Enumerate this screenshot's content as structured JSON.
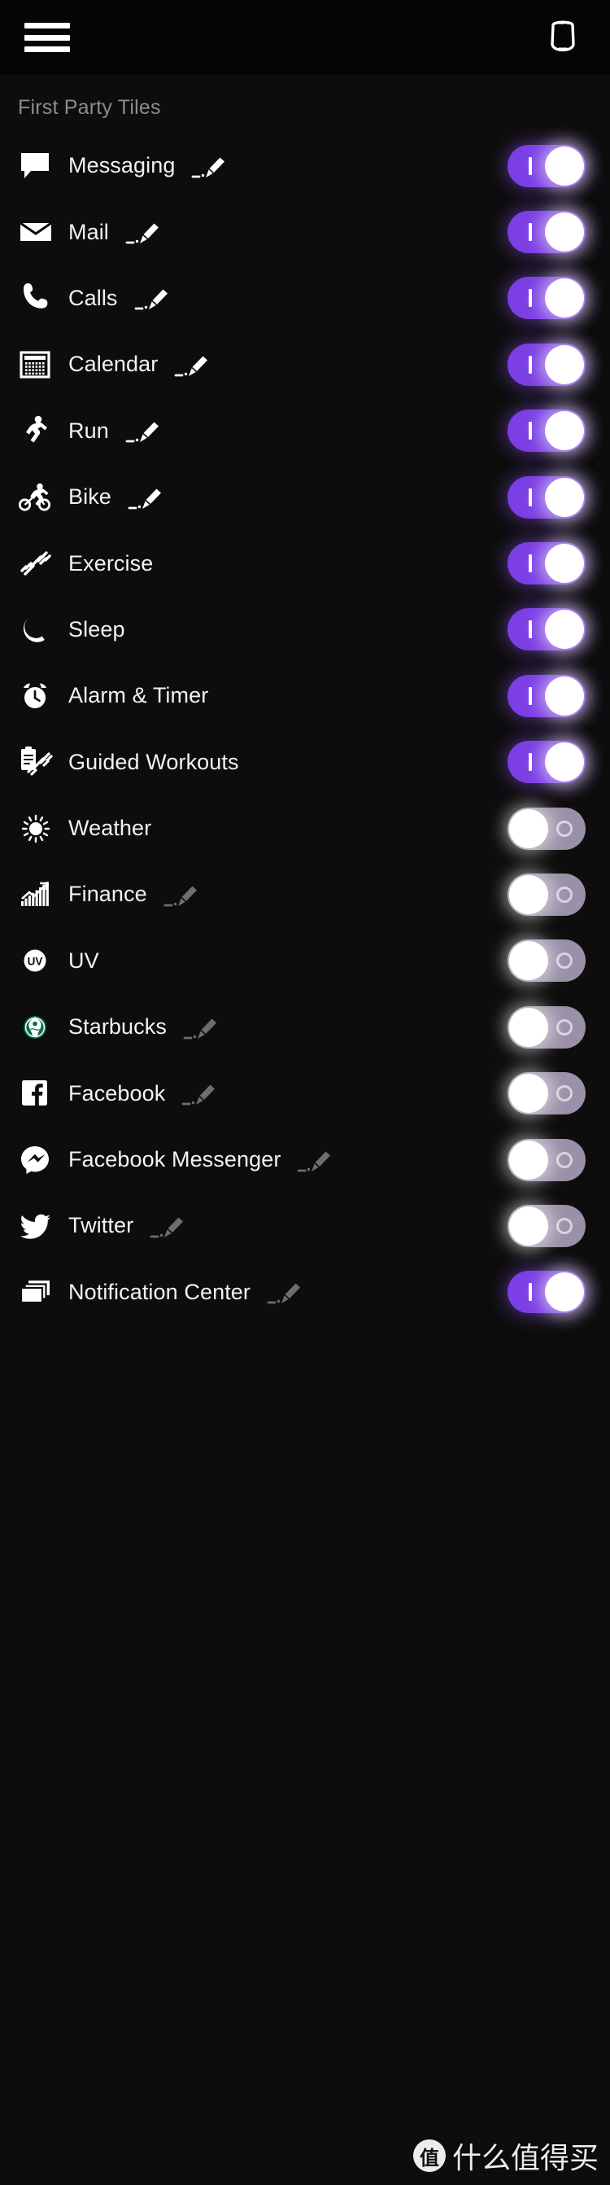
{
  "header": {
    "menu_icon": "hamburger-menu-icon",
    "device_icon": "band-device-icon"
  },
  "section": {
    "title": "First Party Tiles"
  },
  "colors": {
    "toggle_on_track": "#7b3fe4",
    "toggle_off_track": "#9a90a8",
    "knob": "#ffffff",
    "background": "#0d0d0d",
    "appbar_background": "#050505",
    "section_title": "#8c8c8c",
    "label": "#f2f2f2",
    "edit_active": "#ffffff",
    "edit_dimmed": "#6e6e6e",
    "starbucks_green": "#0a6e45",
    "facebook_blue": "#ffffff"
  },
  "toggle_labels": {
    "on_glyph": "I",
    "off_glyph": "O",
    "on_state": "On",
    "off_state": "Off"
  },
  "tiles": [
    {
      "label": "Messaging",
      "icon": "message-bubble-icon",
      "edit": "active",
      "toggle": "on"
    },
    {
      "label": "Mail",
      "icon": "envelope-icon",
      "edit": "active",
      "toggle": "on"
    },
    {
      "label": "Calls",
      "icon": "phone-icon",
      "edit": "active",
      "toggle": "on"
    },
    {
      "label": "Calendar",
      "icon": "calendar-icon",
      "edit": "active",
      "toggle": "on"
    },
    {
      "label": "Run",
      "icon": "runner-icon",
      "edit": "active",
      "toggle": "on"
    },
    {
      "label": "Bike",
      "icon": "cyclist-icon",
      "edit": "active",
      "toggle": "on"
    },
    {
      "label": "Exercise",
      "icon": "dumbbell-icon",
      "edit": "none",
      "toggle": "on"
    },
    {
      "label": "Sleep",
      "icon": "crescent-moon-icon",
      "edit": "none",
      "toggle": "on"
    },
    {
      "label": "Alarm & Timer",
      "icon": "alarm-clock-icon",
      "edit": "none",
      "toggle": "on"
    },
    {
      "label": "Guided Workouts",
      "icon": "clipboard-dumbbell-icon",
      "edit": "none",
      "toggle": "on"
    },
    {
      "label": "Weather",
      "icon": "sun-icon",
      "edit": "none",
      "toggle": "off"
    },
    {
      "label": "Finance",
      "icon": "stock-chart-icon",
      "edit": "dimmed",
      "toggle": "off"
    },
    {
      "label": "UV",
      "icon": "uv-badge-icon",
      "edit": "none",
      "toggle": "off"
    },
    {
      "label": "Starbucks",
      "icon": "starbucks-logo-icon",
      "edit": "dimmed",
      "toggle": "off"
    },
    {
      "label": "Facebook",
      "icon": "facebook-logo-icon",
      "edit": "dimmed",
      "toggle": "off"
    },
    {
      "label": "Facebook Messenger",
      "icon": "messenger-logo-icon",
      "edit": "dimmed",
      "toggle": "off"
    },
    {
      "label": "Twitter",
      "icon": "twitter-bird-icon",
      "edit": "dimmed",
      "toggle": "off"
    },
    {
      "label": "Notification Center",
      "icon": "stacked-cards-icon",
      "edit": "dimmed",
      "toggle": "on"
    }
  ],
  "watermark": {
    "badge": "值",
    "text": "什么值得买"
  }
}
